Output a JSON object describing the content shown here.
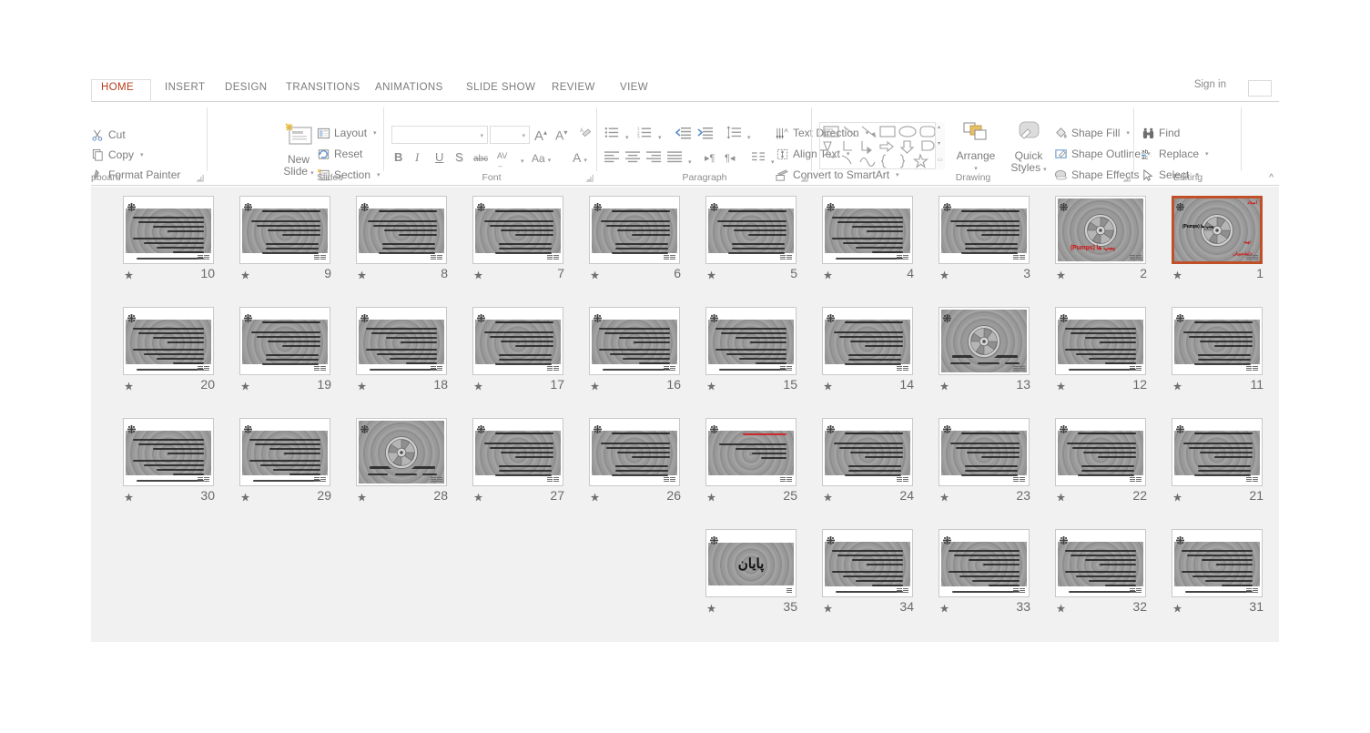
{
  "window": {
    "sign_in": "Sign in",
    "collapse_ribbon": "^"
  },
  "ribbon": {
    "tabs": [
      {
        "label": "HOME",
        "active": true
      },
      {
        "label": "INSERT",
        "active": false
      },
      {
        "label": "DESIGN",
        "active": false
      },
      {
        "label": "TRANSITIONS",
        "active": false
      },
      {
        "label": "ANIMATIONS",
        "active": false
      },
      {
        "label": "SLIDE SHOW",
        "active": false
      },
      {
        "label": "REVIEW",
        "active": false
      },
      {
        "label": "VIEW",
        "active": false
      }
    ],
    "groups": {
      "clipboard": {
        "title": "pboard",
        "cut": "Cut",
        "copy": "Copy",
        "format_painter": "Format Painter"
      },
      "slides": {
        "title": "Slides",
        "new_slide": "New\nSlide",
        "new_slide_l1": "New",
        "new_slide_l2": "Slide",
        "layout": "Layout",
        "reset": "Reset",
        "section": "Section"
      },
      "font": {
        "title": "Font",
        "font_name_value": "",
        "font_size_value": "",
        "grow_font": "A",
        "shrink_font": "A",
        "clear_formatting": "clear-formatting",
        "bold": "B",
        "italic": "I",
        "underline": "U",
        "shadow": "S",
        "strikethrough": "abc",
        "character_spacing": "AV",
        "change_case": "Aa",
        "font_color": "A"
      },
      "paragraph": {
        "title": "Paragraph",
        "text_direction": "Text Direction",
        "align_text": "Align Text",
        "convert_to_smartart": "Convert to SmartArt"
      },
      "drawing": {
        "title": "Drawing",
        "arrange": "Arrange",
        "quick_styles_l1": "Quick",
        "quick_styles_l2": "Styles",
        "shape_fill": "Shape Fill",
        "shape_outline": "Shape Outline",
        "shape_effects": "Shape Effects"
      },
      "editing": {
        "title": "Editing",
        "find": "Find",
        "replace": "Replace",
        "select": "Select"
      }
    }
  },
  "sorter": {
    "selected_slide": 1,
    "accent_color": "#c0502a",
    "background_color": "#f1f1f1",
    "rows": [
      {
        "slides": [
          {
            "number": "10",
            "kind": "body",
            "animated": true
          },
          {
            "number": "9",
            "kind": "title-body",
            "animated": true
          },
          {
            "number": "8",
            "kind": "title-body",
            "animated": true
          },
          {
            "number": "7",
            "kind": "title-body",
            "animated": true
          },
          {
            "number": "6",
            "kind": "title-body",
            "animated": true
          },
          {
            "number": "5",
            "kind": "title-body",
            "animated": true
          },
          {
            "number": "4",
            "kind": "body",
            "animated": true
          },
          {
            "number": "3",
            "kind": "title-body",
            "animated": true
          },
          {
            "number": "2",
            "kind": "wheel-red",
            "animated": true,
            "caption": "(Pumps) پمپ‌ها"
          },
          {
            "number": "1",
            "kind": "title-slide",
            "animated": true,
            "selected": true,
            "caption": "(Pumps) پمپ‌ها"
          }
        ]
      },
      {
        "slides": [
          {
            "number": "20",
            "kind": "body",
            "animated": true
          },
          {
            "number": "19",
            "kind": "title-body",
            "animated": true
          },
          {
            "number": "18",
            "kind": "body",
            "animated": true
          },
          {
            "number": "17",
            "kind": "title-body",
            "animated": true
          },
          {
            "number": "16",
            "kind": "body",
            "animated": true
          },
          {
            "number": "15",
            "kind": "body",
            "animated": true
          },
          {
            "number": "14",
            "kind": "title-body",
            "animated": true
          },
          {
            "number": "13",
            "kind": "wheel-dark",
            "animated": true
          },
          {
            "number": "12",
            "kind": "body",
            "animated": true
          },
          {
            "number": "11",
            "kind": "title-body",
            "animated": true
          }
        ]
      },
      {
        "slides": [
          {
            "number": "30",
            "kind": "body",
            "animated": true
          },
          {
            "number": "29",
            "kind": "body",
            "animated": true
          },
          {
            "number": "28",
            "kind": "wheel-dark",
            "animated": true
          },
          {
            "number": "27",
            "kind": "title-body",
            "animated": true
          },
          {
            "number": "26",
            "kind": "title-body",
            "animated": true
          },
          {
            "number": "25",
            "kind": "red-title",
            "animated": true
          },
          {
            "number": "24",
            "kind": "title-body",
            "animated": true
          },
          {
            "number": "23",
            "kind": "title-body",
            "animated": true
          },
          {
            "number": "22",
            "kind": "title-body",
            "animated": true
          },
          {
            "number": "21",
            "kind": "title-body",
            "animated": true
          }
        ]
      },
      {
        "slides": [
          {
            "number": "35",
            "kind": "end",
            "animated": true,
            "caption": "پایان"
          },
          {
            "number": "34",
            "kind": "body",
            "animated": true
          },
          {
            "number": "33",
            "kind": "body",
            "animated": true
          },
          {
            "number": "32",
            "kind": "body",
            "animated": true
          },
          {
            "number": "31",
            "kind": "body",
            "animated": true
          }
        ]
      }
    ]
  }
}
